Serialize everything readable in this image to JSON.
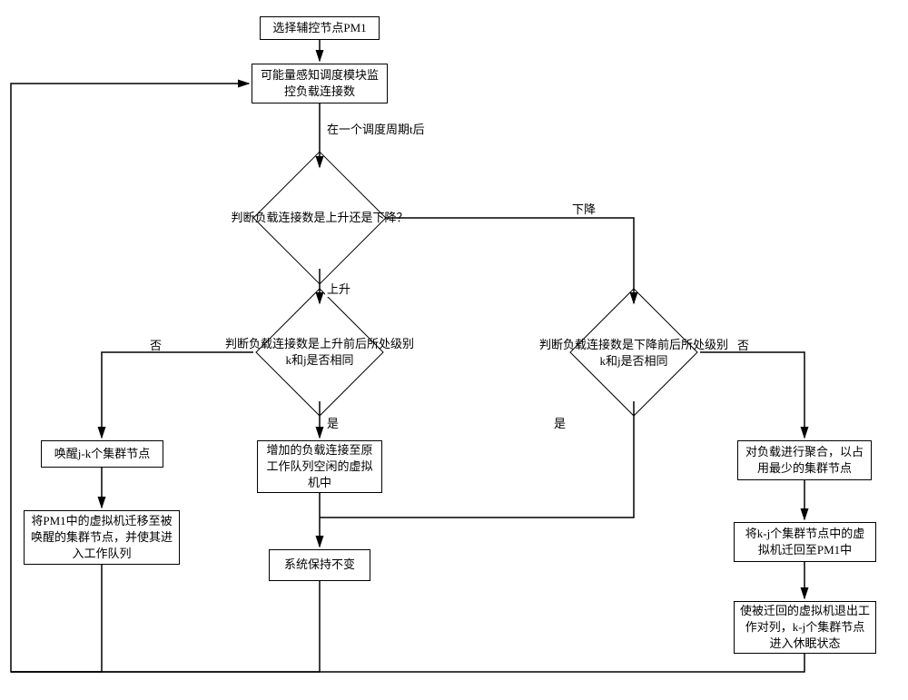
{
  "chart_data": {
    "type": "flowchart",
    "nodes": {
      "start": "选择辅控节点PM1",
      "monitor": "可能量感知调度模块监控负载连接数",
      "afterCycle": "在一个调度周期t后",
      "judgeUpDown": "判断负载连接数是上升还是下降？",
      "rising": "上升",
      "falling": "下降",
      "judgeRiseSame": "判断负载连接数是上升前后所处级别k和j是否相同",
      "judgeFallSame": "判断负载连接数是下降前后所处级别k和j是否相同",
      "yes": "是",
      "no": "否",
      "wakeNodes": "唤醒j-k个集群节点",
      "migrateFromPM1": "将PM1中的虚拟机迁移至被唤醒的集群节点，并使其进入工作队列",
      "addLoad": "增加的负载连接至原工作队列空闲的虚拟机中",
      "aggregate": "对负载进行聚合，以占用最少的集群节点",
      "migrateToPM1": "将k-j个集群节点中的虚拟机迁回至PM1中",
      "exitQueue": "使被迁回的虚拟机退出工作对列，k-j个集群节点进入休眠状态",
      "systemUnchanged": "系统保持不变"
    }
  }
}
